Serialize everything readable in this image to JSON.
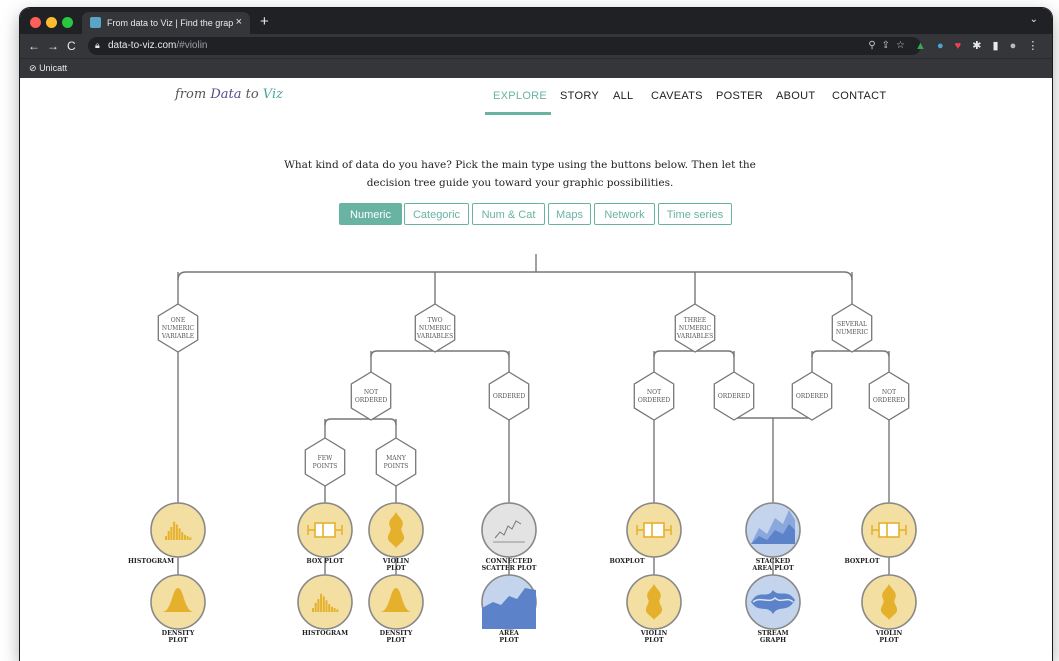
{
  "browser": {
    "tab_title": "From data to Viz | Find the grap",
    "tab_close": "×",
    "new_tab": "+",
    "url_host": "data-to-viz.com",
    "url_path": "/#violin",
    "bookmark": "Unicatt"
  },
  "site": {
    "logo_pre": "from ",
    "logo_data": "Data",
    "logo_mid": " to ",
    "logo_viz": "Viz",
    "nav": [
      "EXPLORE",
      "STORY",
      "ALL",
      "CAVEATS",
      "POSTER",
      "ABOUT",
      "CONTACT"
    ],
    "active_nav": "EXPLORE"
  },
  "intro": {
    "line1": "What kind of data do you have? Pick the main type using the buttons below. Then let the",
    "line2": "decision tree guide you toward your graphic possibilities."
  },
  "data_types": [
    "Numeric",
    "Categoric",
    "Num & Cat",
    "Maps",
    "Network",
    "Time series"
  ],
  "active_type": "Numeric",
  "tree": {
    "level1": [
      [
        "ONE",
        "NUMERIC",
        "VARIABLE"
      ],
      [
        "TWO",
        "NUMERIC",
        "VARIABLES"
      ],
      [
        "THREE",
        "NUMERIC",
        "VARIABLES"
      ],
      [
        "SEVERAL",
        "NUMERIC"
      ]
    ],
    "level2": [
      [
        "NOT",
        "ORDERED"
      ],
      [
        "ORDERED"
      ],
      [
        "NOT",
        "ORDERED"
      ],
      [
        "ORDERED"
      ],
      [
        "ORDERED"
      ],
      [
        "NOT",
        "ORDERED"
      ]
    ],
    "level3": [
      [
        "FEW",
        "POINTS"
      ],
      [
        "MANY",
        "POINTS"
      ]
    ],
    "leaf_labels": [
      [
        "HISTOGRAM"
      ],
      [
        "DENSITY",
        "PLOT"
      ],
      [
        "BOX PLOT"
      ],
      [
        "HISTOGRAM"
      ],
      [
        "VIOLIN",
        "PLOT"
      ],
      [
        "DENSITY",
        "PLOT"
      ],
      [
        "CONNECTED",
        "SCATTER PLOT"
      ],
      [
        "AREA",
        "PLOT"
      ],
      [
        "BOXPLOT"
      ],
      [
        "VIOLIN",
        "PLOT"
      ],
      [
        "STACKED",
        "AREA PLOT"
      ],
      [
        "STREAM",
        "GRAPH"
      ],
      [
        "BOXPLOT"
      ],
      [
        "VIOLIN",
        "PLOT"
      ]
    ]
  },
  "colors": {
    "accent": "#69b3a2",
    "yellow_fill": "#f3dfa2",
    "yellow_mark": "#e5b12c",
    "blue_fill": "#c3d4ec",
    "blue_mark": "#5c83c9",
    "grey_fill": "#e3e3e3",
    "chrome_dark": "#202124",
    "chrome_mid": "#35363a"
  }
}
